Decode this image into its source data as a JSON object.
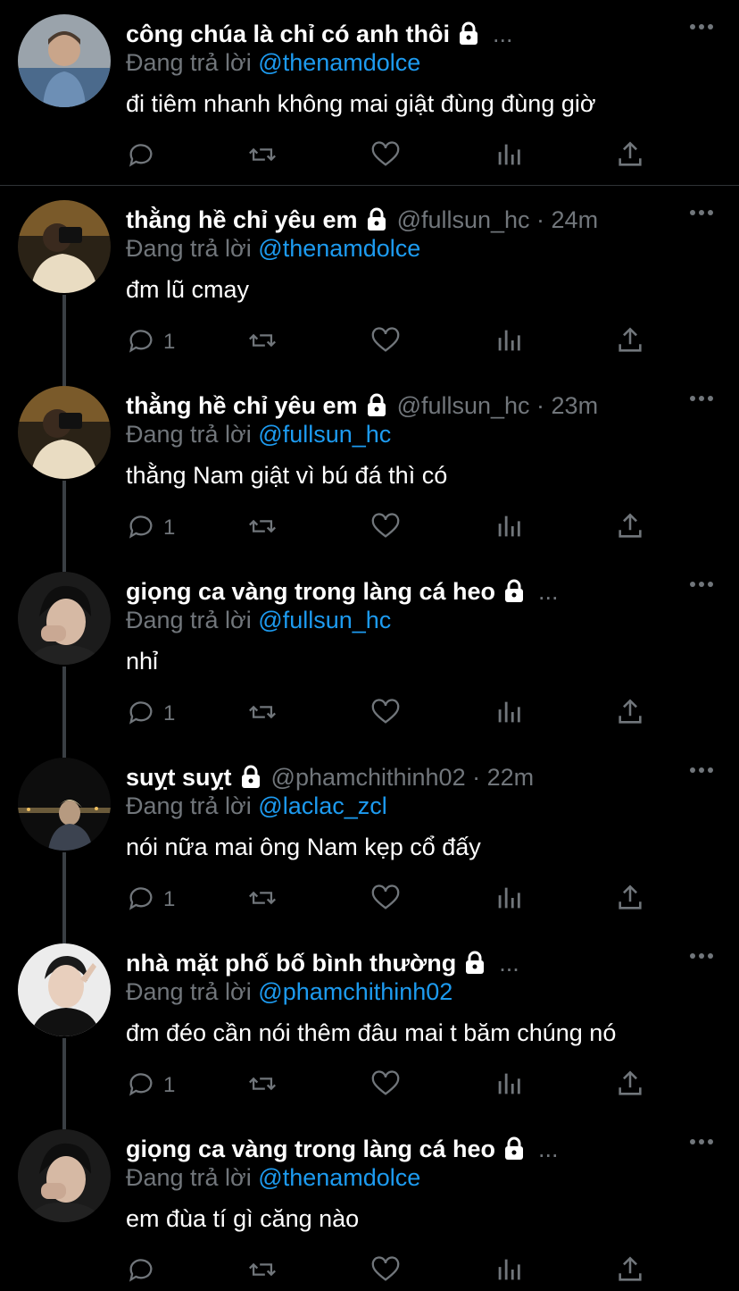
{
  "reply_prefix": "Đang trả lời",
  "colors": {
    "background": "#000000",
    "text": "#ffffff",
    "muted": "#71767b",
    "mention": "#1d9bf0",
    "thread_line": "#3a3f44"
  },
  "icons": {
    "reply": "reply-icon",
    "retweet": "retweet-icon",
    "like": "heart-icon",
    "views": "analytics-icon",
    "share": "share-icon",
    "more": "more-icon",
    "lock": "lock-icon"
  },
  "tweets": [
    {
      "name": "công chúa là chỉ có anh thôi",
      "handle": "",
      "time": "",
      "truncated": "...",
      "reply_to": "@thenamdolce",
      "text": "đi tiêm nhanh không mai giật đùng đùng giờ",
      "reply_count": ""
    },
    {
      "name": "thằng hề chỉ yêu em",
      "handle": "@fullsun_hc · 24m",
      "time": "",
      "truncated": "",
      "reply_to": "@thenamdolce",
      "text": "đm lũ cmay",
      "reply_count": "1"
    },
    {
      "name": "thằng hề chỉ yêu em",
      "handle": "@fullsun_hc · 23m",
      "time": "",
      "truncated": "",
      "reply_to": "@fullsun_hc",
      "text": "thằng Nam giật vì bú đá thì có",
      "reply_count": "1"
    },
    {
      "name": "giọng ca vàng trong làng cá heo",
      "handle": "",
      "time": "",
      "truncated": "...",
      "reply_to": "@fullsun_hc",
      "text": "nhỉ",
      "reply_count": "1"
    },
    {
      "name": "suỵt suỵt",
      "handle": "@phamchithinh02 · 22m",
      "time": "",
      "truncated": "",
      "reply_to": "@laclac_zcl",
      "text": "nói nữa mai ông Nam kẹp cổ đấy",
      "reply_count": "1"
    },
    {
      "name": "nhà mặt phố bố bình thường",
      "handle": "",
      "time": "",
      "truncated": "...",
      "reply_to": "@phamchithinh02",
      "text": "đm đéo cần nói thêm đâu mai t băm chúng nó",
      "reply_count": "1"
    },
    {
      "name": "giọng ca vàng trong làng cá heo",
      "handle": "",
      "time": "",
      "truncated": "...",
      "reply_to": "@thenamdolce",
      "text": "em đùa tí gì căng nào",
      "reply_count": ""
    }
  ]
}
